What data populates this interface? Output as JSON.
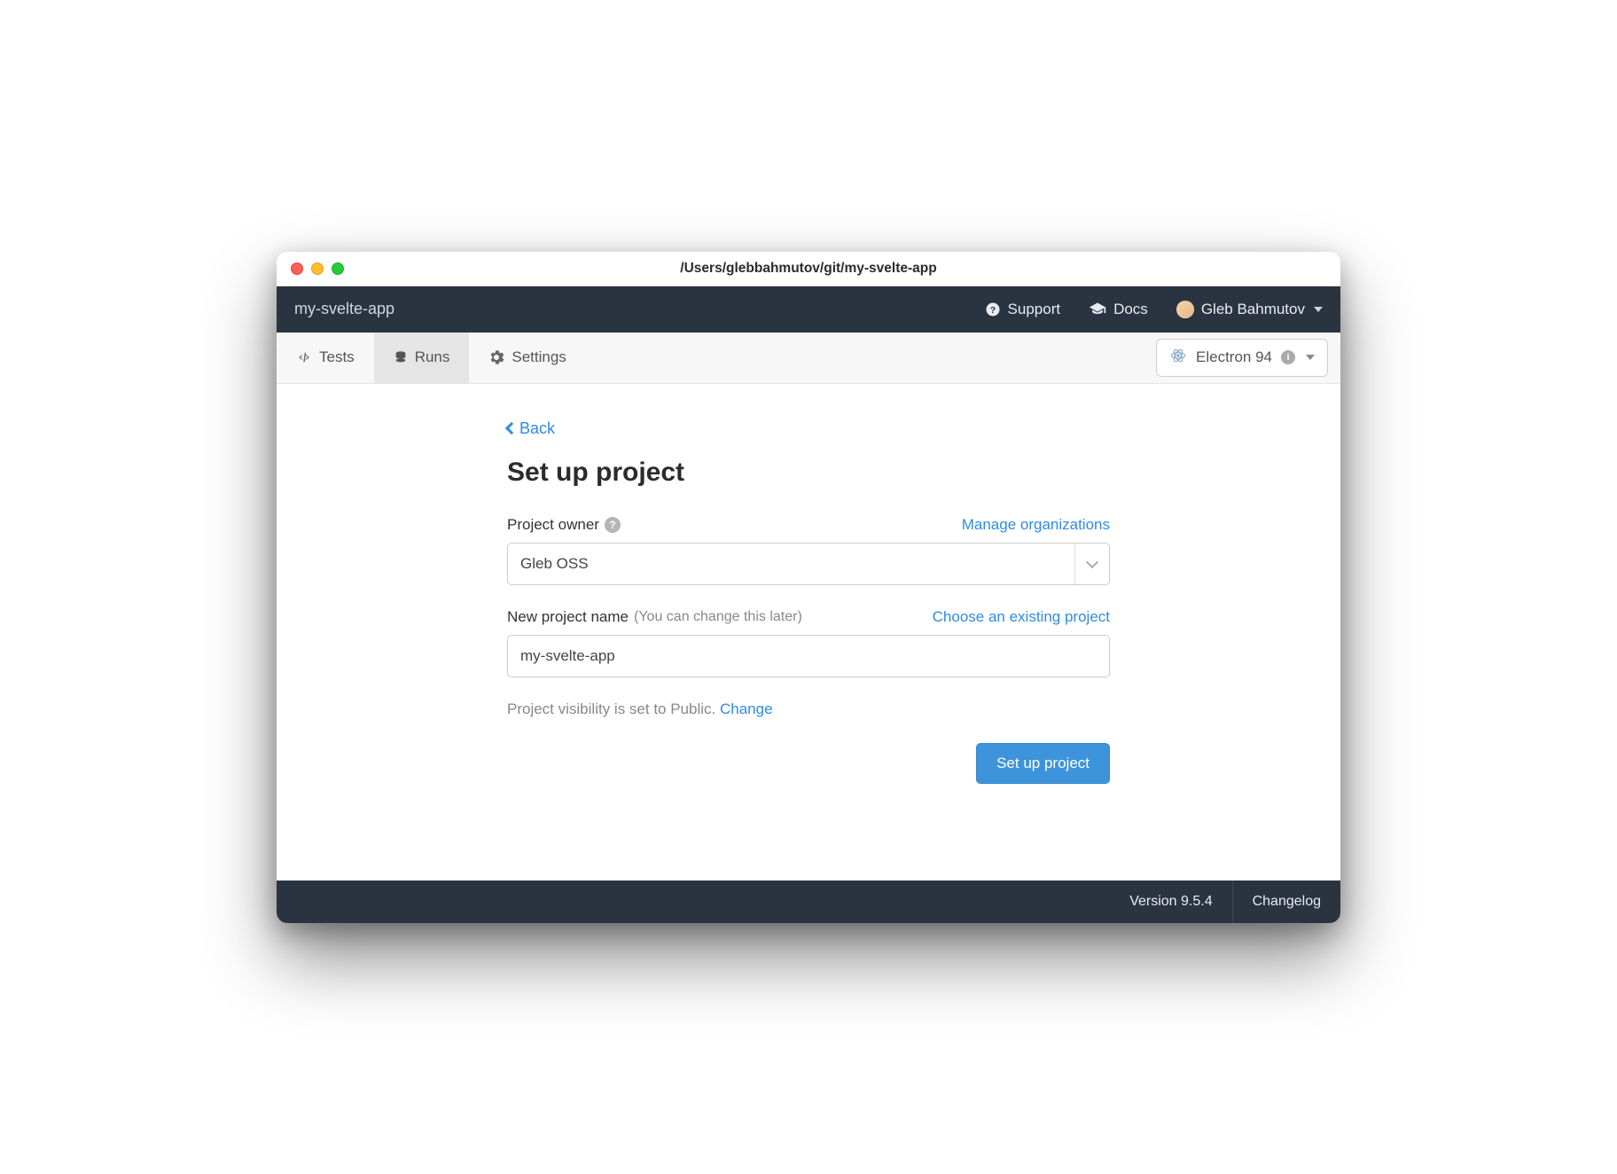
{
  "window": {
    "title": "/Users/glebbahmutov/git/my-svelte-app"
  },
  "navbar": {
    "app_name": "my-svelte-app",
    "support": "Support",
    "docs": "Docs",
    "user_name": "Gleb Bahmutov"
  },
  "tabs": {
    "tests": "Tests",
    "runs": "Runs",
    "settings": "Settings"
  },
  "browser_select": {
    "label": "Electron 94"
  },
  "page": {
    "back": "Back",
    "title": "Set up project",
    "owner_label": "Project owner",
    "manage_orgs": "Manage organizations",
    "owner_value": "Gleb OSS",
    "name_label": "New project name",
    "name_sublabel": "(You can change this later)",
    "choose_existing": "Choose an existing project",
    "name_value": "my-svelte-app",
    "visibility_text": "Project visibility is set to Public. ",
    "visibility_change": "Change",
    "submit": "Set up project"
  },
  "footer": {
    "version": "Version 9.5.4",
    "changelog": "Changelog"
  }
}
